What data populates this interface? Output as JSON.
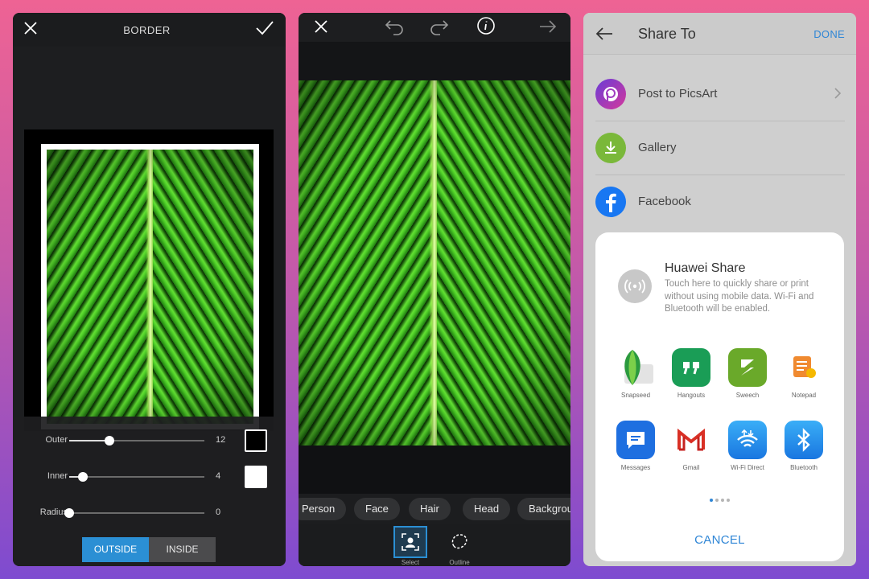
{
  "border_screen": {
    "title": "BORDER",
    "sliders": [
      {
        "label": "Outer",
        "value": "12",
        "level": 0.3,
        "swatch": "#000000"
      },
      {
        "label": "Inner",
        "value": "4",
        "level": 0.1,
        "swatch": "#ffffff"
      },
      {
        "label": "Radius",
        "value": "0",
        "level": 0.0
      }
    ],
    "toggle": {
      "outside": "OUTSIDE",
      "inside": "INSIDE",
      "selected": "OUTSIDE"
    },
    "accent": "#2b8fd4"
  },
  "select_screen": {
    "chips": [
      "Person",
      "Face",
      "Hair",
      "Head",
      "Background"
    ],
    "tools": [
      {
        "label": "Select",
        "active": true
      },
      {
        "label": "Outline",
        "active": false
      }
    ]
  },
  "share_screen": {
    "title": "Share To",
    "done": "DONE",
    "targets": [
      "Post to PicsArt",
      "Gallery",
      "Facebook"
    ],
    "huawei": {
      "title": "Huawei Share",
      "description": "Touch here to quickly share or print without using mobile data. Wi-Fi and Bluetooth will be enabled."
    },
    "apps": [
      "Snapseed",
      "Hangouts",
      "Sweech",
      "Notepad",
      "Messages",
      "Gmail",
      "Wi-Fi Direct",
      "Bluetooth"
    ],
    "cancel": "CANCEL",
    "accent": "#2f86d6"
  }
}
